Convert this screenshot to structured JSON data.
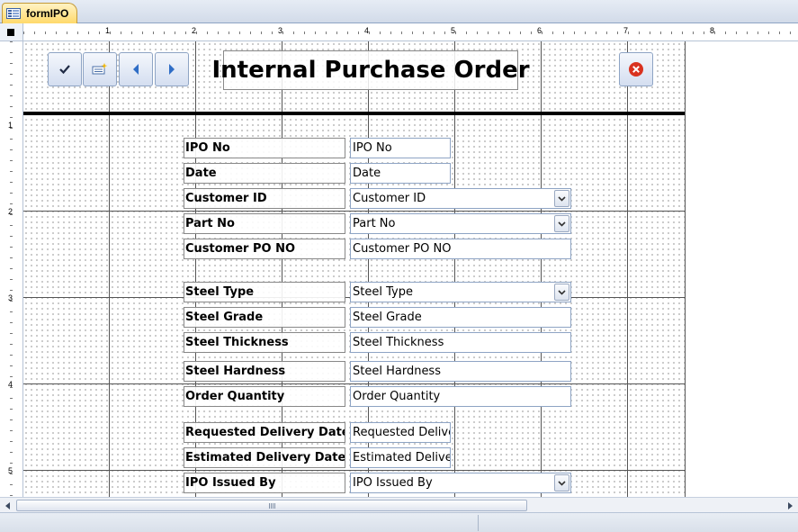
{
  "tab": {
    "label": "formIPO",
    "icon": "form-icon"
  },
  "ruler": {
    "horizontal": [
      "1",
      "2",
      "3",
      "4",
      "5",
      "6",
      "7",
      "8"
    ],
    "vertical": [
      "1",
      "2",
      "3",
      "4",
      "5"
    ]
  },
  "header": {
    "title": "Internal Purchase Order",
    "buttons": [
      {
        "icon": "checkmark-icon",
        "name": "save-record-button"
      },
      {
        "icon": "new-record-icon",
        "name": "new-record-button"
      },
      {
        "icon": "arrow-left-icon",
        "name": "previous-record-button"
      },
      {
        "icon": "arrow-right-icon",
        "name": "next-record-button"
      },
      {
        "icon": "close-icon",
        "name": "close-form-button"
      }
    ]
  },
  "form": {
    "fields": [
      {
        "label": "IPO No",
        "value": "IPO No",
        "type": "text"
      },
      {
        "label": "Date",
        "value": "Date",
        "type": "text"
      },
      {
        "label": "Customer ID",
        "value": "Customer ID",
        "type": "combo"
      },
      {
        "label": "Part No",
        "value": "Part No",
        "type": "combo"
      },
      {
        "label": "Customer PO NO",
        "value": "Customer PO NO",
        "type": "text"
      },
      {
        "label": "Steel Type",
        "value": "Steel Type",
        "type": "combo"
      },
      {
        "label": "Steel Grade",
        "value": "Steel Grade",
        "type": "text"
      },
      {
        "label": "Steel Thickness",
        "value": "Steel Thickness",
        "type": "text"
      },
      {
        "label": "Steel Hardness",
        "value": "Steel Hardness",
        "type": "text"
      },
      {
        "label": "Order Quantity",
        "value": "Order Quantity",
        "type": "text"
      },
      {
        "label": "Requested Delivery Date",
        "value": "Requested Delive",
        "type": "text"
      },
      {
        "label": "Estimated Delivery Date",
        "value": "Estimated Deliver",
        "type": "text"
      },
      {
        "label": "IPO Issued By",
        "value": "IPO Issued By",
        "type": "combo"
      }
    ]
  },
  "colors": {
    "tab_active": "#ffd96b",
    "close_icon": "#d9321f",
    "nav_icon": "#2f6dc6"
  }
}
